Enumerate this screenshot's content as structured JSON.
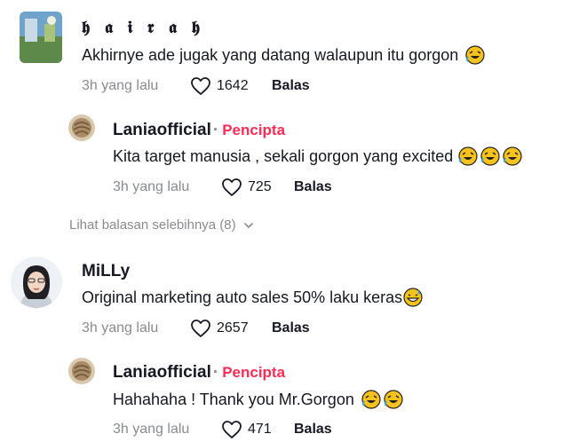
{
  "comments": [
    {
      "author": "𝖍 𝖆 𝖎 𝖗 𝖆 𝖍",
      "text": "Akhirnye ade jugak yang datang walaupun itu gorgon",
      "emoji_count": 1,
      "time": "3h yang lalu",
      "likes": "1642",
      "reply_label": "Balas",
      "replies": [
        {
          "author": "Laniaofficial",
          "separator": "·",
          "badge": "Pencipta",
          "text": "Kita target manusia , sekali gorgon yang excited",
          "emoji_count": 3,
          "time": "3h yang lalu",
          "likes": "725",
          "reply_label": "Balas"
        }
      ],
      "more_replies": "Lihat balasan selebihnya (8)"
    },
    {
      "author": "MiLLy",
      "text": "Original marketing auto sales 50% laku keras",
      "emoji_count": 1,
      "time": "3h yang lalu",
      "likes": "2657",
      "reply_label": "Balas",
      "replies": [
        {
          "author": "Laniaofficial",
          "separator": "·",
          "badge": "Pencipta",
          "text": "Hahahaha ! Thank you Mr.Gorgon",
          "emoji_count": 2,
          "time": "3h yang lalu",
          "likes": "471",
          "reply_label": "Balas"
        }
      ]
    }
  ],
  "icons": {
    "like": "heart-outline-icon",
    "emoji_laugh": "rolling-laughing-emoji",
    "emoji_sweat": "grinning-sweat-emoji",
    "chevron": "chevron-down-icon"
  },
  "colors": {
    "creator_badge": "#fe2c55",
    "muted_text": "#8a8b91",
    "primary_text": "#161823",
    "emoji_yellow": "#f7c21c"
  }
}
